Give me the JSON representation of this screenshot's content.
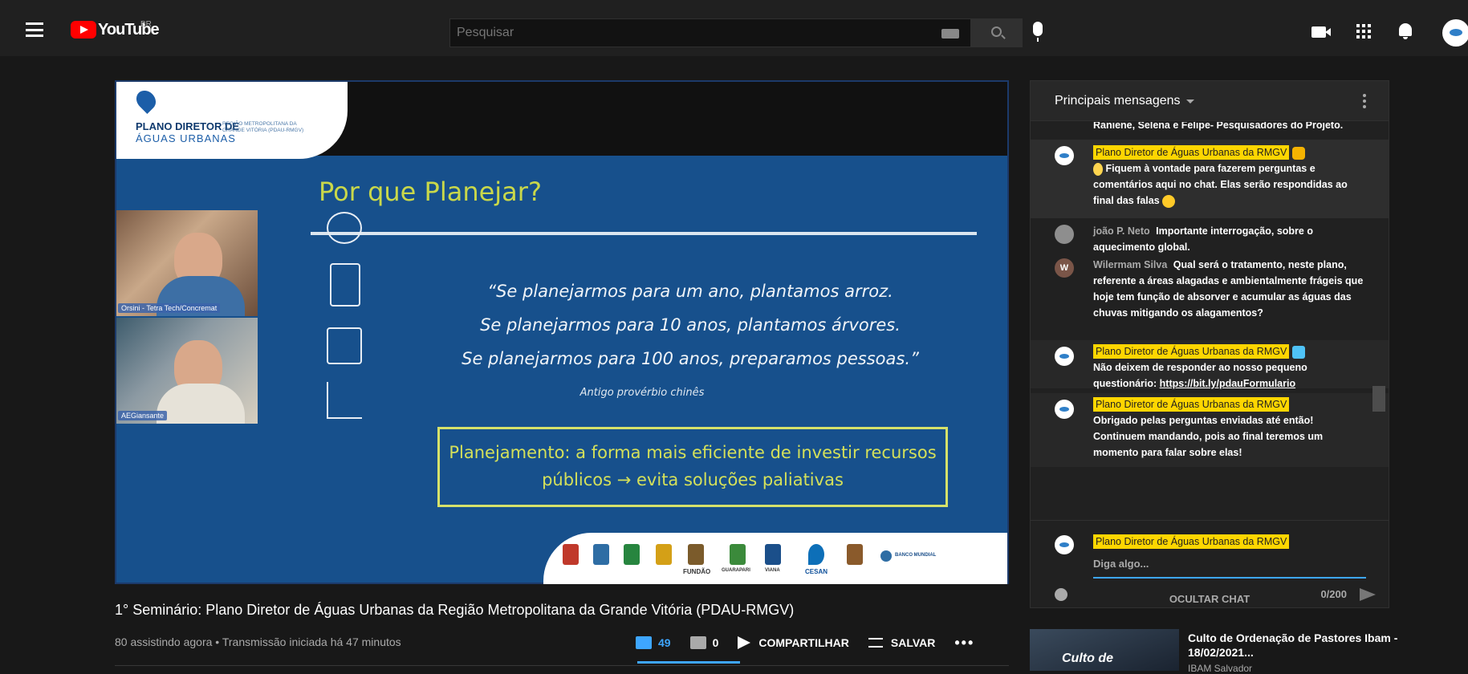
{
  "header": {
    "logo_text": "YouTube",
    "country": "BR",
    "search_placeholder": "Pesquisar"
  },
  "slide": {
    "logo_line1": "PLANO DIRETOR DE",
    "logo_line2": "ÁGUAS URBANAS",
    "logo_sub": "REGIÃO METROPOLITANA DA GRANDE VITÓRIA (PDAU-RMGV)",
    "title": "Por que Planejar?",
    "quote_lines": [
      "“Se planejarmos para um ano, plantamos arroz.",
      "Se planejarmos para 10 anos, plantamos árvores.",
      "Se planejarmos para 100 anos, preparamos pessoas.”"
    ],
    "quote_source": "Antigo provérbio chinês",
    "box_line1": "Planejamento: a forma mais eficiente de investir recursos",
    "box_line2": "públicos → evita soluções paliativas",
    "cam1_label": "Orsini - Tetra Tech/Concremat",
    "cam2_label": "AEGiansante",
    "sponsor_fundacao": "FUNDÃO",
    "sponsor_guarapari": "GUARAPARI",
    "sponsor_viana": "VIANA",
    "sponsor_cesan": "CESAN",
    "sponsor_banco": "BANCO MUNDIAL"
  },
  "video": {
    "title": "1° Seminário: Plano Diretor de Águas Urbanas da Região Metropolitana da Grande Vitória (PDAU-RMGV)",
    "meta": "80 assistindo agora • Transmissão iniciada há 47 minutos",
    "likes": "49",
    "dislikes": "0",
    "share_label": "COMPARTILHAR",
    "save_label": "SALVAR",
    "more_label": "•••"
  },
  "chat": {
    "title": "Principais mensagens",
    "messages": [
      {
        "author": "",
        "text": "Raniene, Selena e Felipe- Pesquisadores do Projeto."
      },
      {
        "author": "Plano Diretor de Águas Urbanas da RMGV",
        "text": "Fiquem à vontade para fazerem perguntas e comentários aqui no chat. Elas serão respondidas ao final das falas"
      },
      {
        "author": "joão P. Neto",
        "text": "Importante interrogação, sobre o aquecimento global."
      },
      {
        "author": "Wilermam Silva",
        "text": "Qual será o tratamento, neste plano, referente a áreas alagadas e ambientalmente frágeis que hoje tem função de absorver e acumular as águas das chuvas mitigando os alagamentos?"
      },
      {
        "author": "Plano Diretor de Águas Urbanas da RMGV",
        "text": "Não deixem de responder ao nosso pequeno questionário:",
        "link": "https://bit.ly/pdauFormulario"
      },
      {
        "author": "Plano Diretor de Águas Urbanas da RMGV",
        "text": "Obrigado pelas perguntas enviadas até então! Continuem mandando, pois ao final teremos um momento para falar sobre elas!"
      }
    ],
    "avatar_initial_w": "W",
    "composer_author": "Plano Diretor de Águas Urbanas da RMGV",
    "composer_placeholder": "Diga algo...",
    "char_count": "0/200",
    "hide_label": "OCULTAR CHAT"
  },
  "recommendation": {
    "title": "Culto de Ordenação de Pastores Ibam - 18/02/2021...",
    "channel": "IBAM Salvador",
    "thumb_text": "Culto de"
  },
  "colors": {
    "youtube_red": "#ff0000",
    "accent_blue": "#3ea6ff",
    "moderator_yellow": "#ffd600",
    "slide_blue": "#17508c",
    "slide_title_yellow": "#c9d84a"
  },
  "icons": [
    "menu-icon",
    "search-icon",
    "keyboard-icon",
    "mic-icon",
    "create-video-icon",
    "apps-icon",
    "bell-icon",
    "avatar",
    "like-icon",
    "dislike-icon",
    "share-icon",
    "save-icon",
    "emoji-icon",
    "send-icon",
    "kebab-icon"
  ]
}
